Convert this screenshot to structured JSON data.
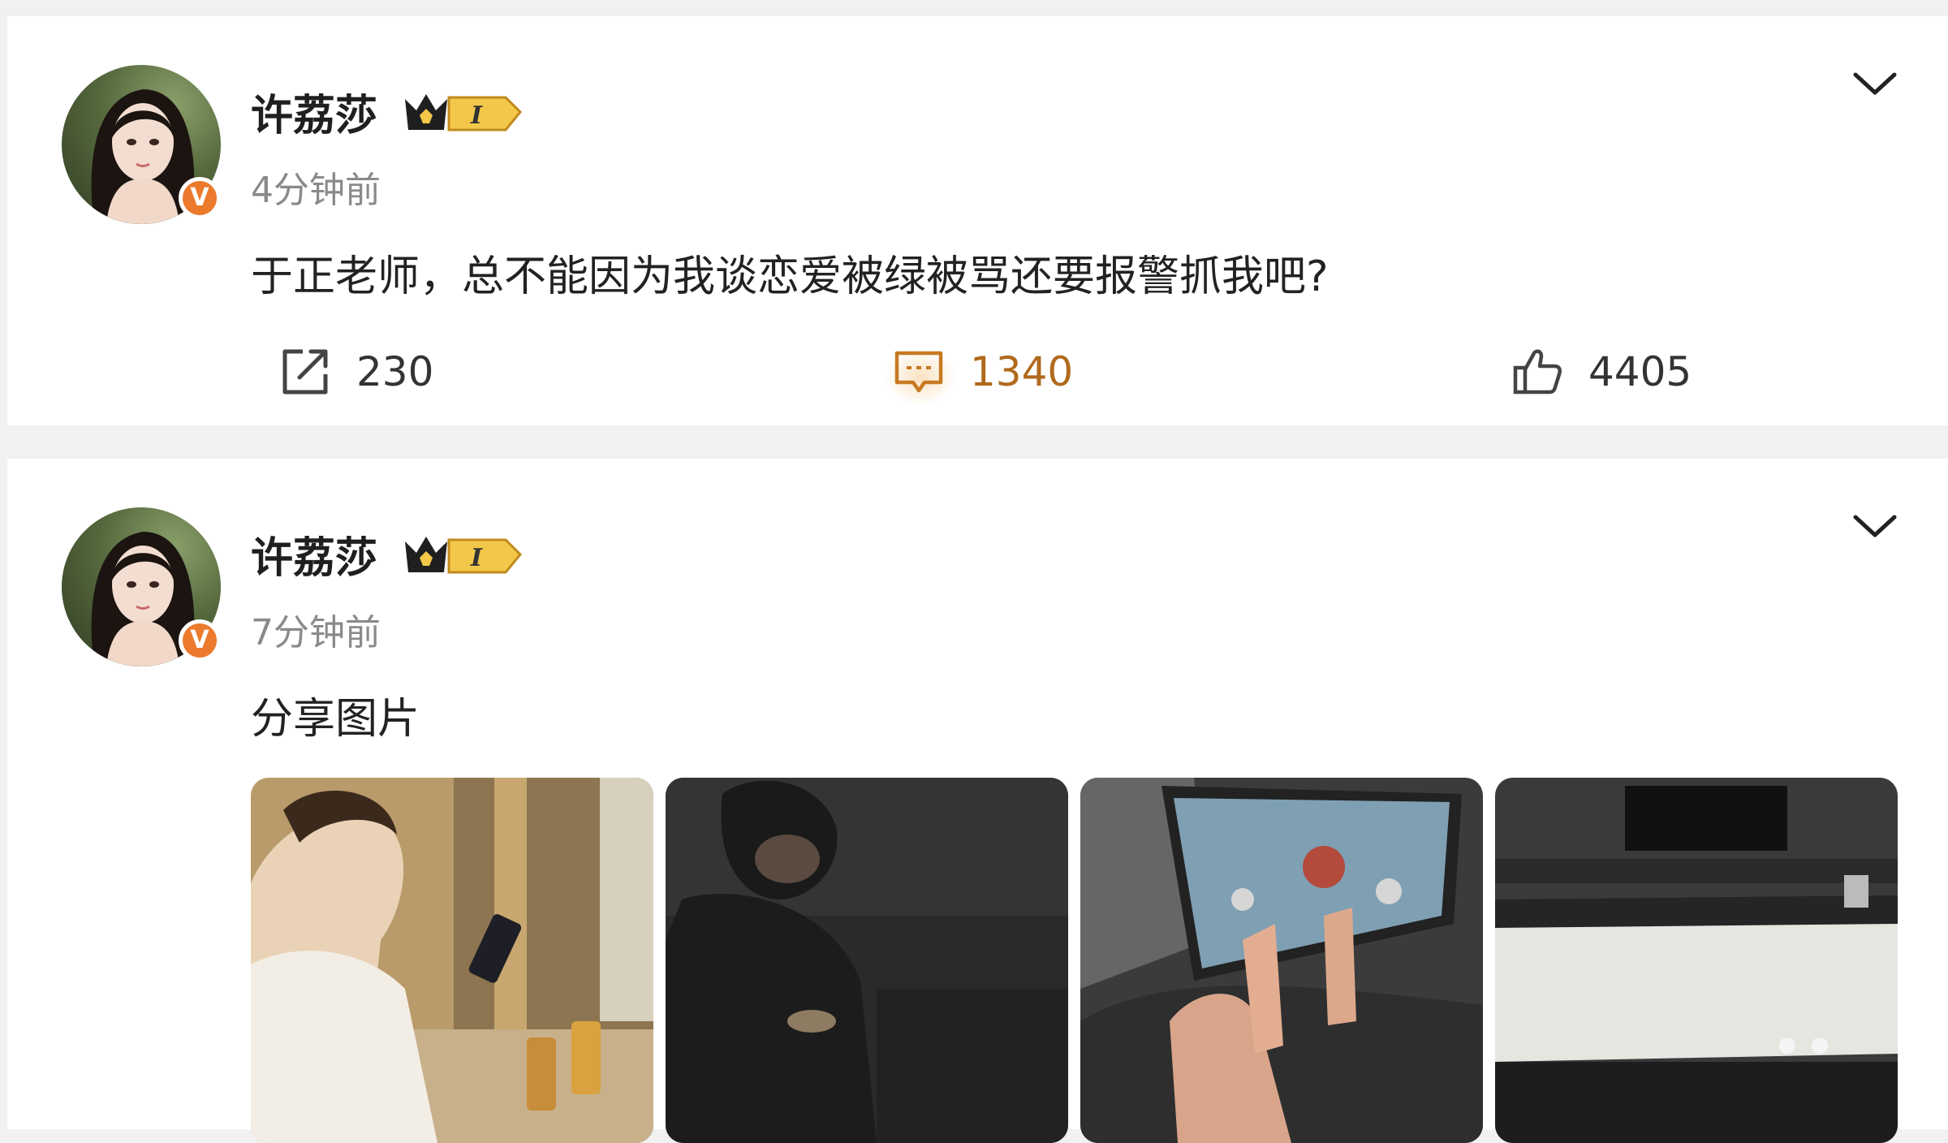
{
  "posts": [
    {
      "username": "许荔莎",
      "vip_level": "I",
      "time": "4分钟前",
      "text": "于正老师，总不能因为我谈恋爱被绿被骂还要报警抓我吧?",
      "actions": {
        "repost_count": "230",
        "comment_count": "1340",
        "like_count": "4405"
      }
    },
    {
      "username": "许荔莎",
      "vip_level": "I",
      "time": "7分钟前",
      "text": "分享图片",
      "images": [
        {
          "icon": "photo-man-phone"
        },
        {
          "icon": "photo-dark-room"
        },
        {
          "icon": "photo-tablet-game"
        },
        {
          "icon": "photo-hotel-bed"
        }
      ]
    }
  ],
  "colors": {
    "verified_badge": "#ec7a2c",
    "comment_accent": "#b06a1c",
    "vip_gold": "#f3c84a"
  }
}
